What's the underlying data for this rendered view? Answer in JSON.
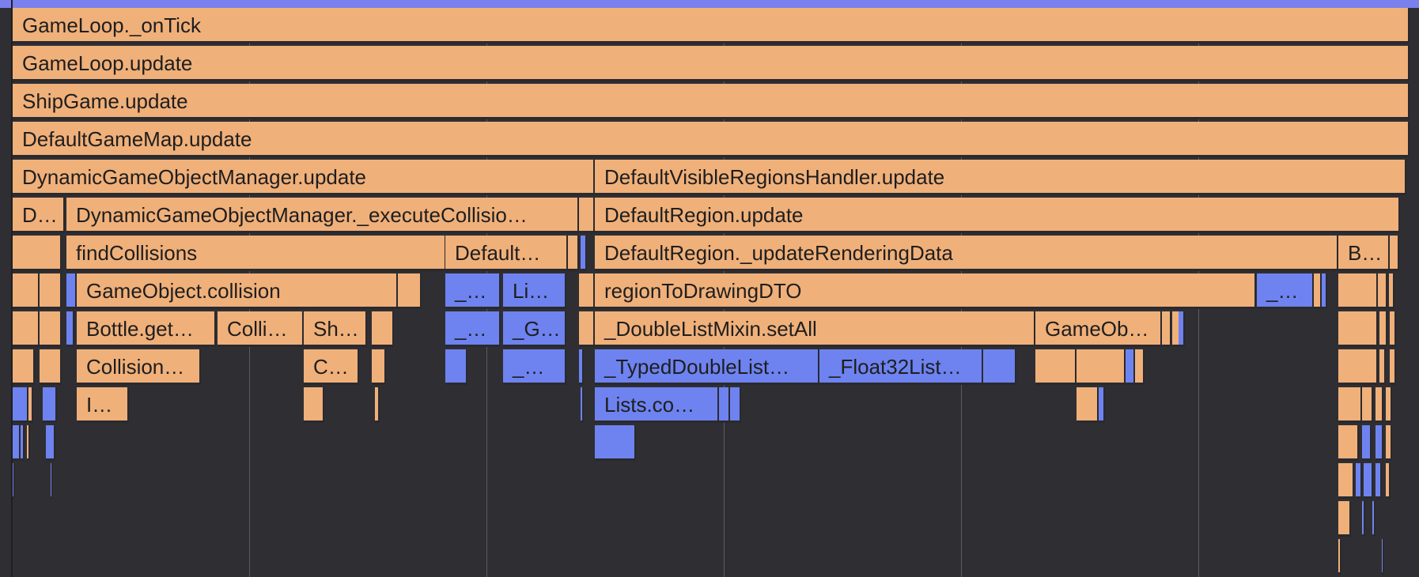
{
  "colors": {
    "background": "#2f2f33",
    "app_code": "#f0b07a",
    "native_code": "#6e83f0",
    "gridline": "#5b5b60",
    "top_bar": "#7a80ee"
  },
  "frames": {
    "r0": [
      "GameLoop._onTick"
    ],
    "r1": [
      "GameLoop.update"
    ],
    "r2": [
      "ShipGame.update"
    ],
    "r3": [
      "DefaultGameMap.update"
    ],
    "r4": [
      "DynamicGameObjectManager.update",
      "DefaultVisibleRegionsHandler.update"
    ],
    "r5": [
      "D…",
      "DynamicGameObjectManager._executeCollisio…",
      "DefaultRegion.update"
    ],
    "r6": [
      "findCollisions",
      "Default…",
      "DefaultRegion._updateRenderingData",
      "B…"
    ],
    "r7": [
      "GameObject.collision",
      "_…",
      "Li…",
      "regionToDrawingDTO",
      "_…"
    ],
    "r8": [
      "Bottle.get…",
      "Colli…",
      "Sh…",
      "_…",
      "_G…",
      "_DoubleListMixin.setAll",
      "GameOb…"
    ],
    "r9": [
      "Collision…",
      "C…",
      "_…",
      "_TypedDoubleList…",
      "_Float32List…"
    ],
    "r10": [
      "I…",
      "Lists.co…"
    ]
  }
}
